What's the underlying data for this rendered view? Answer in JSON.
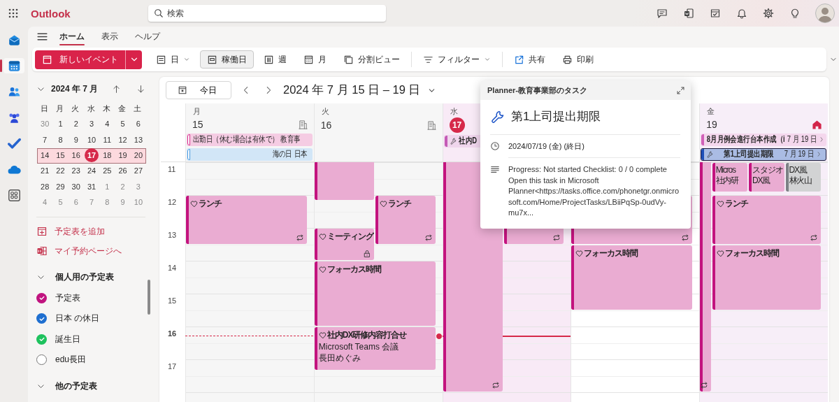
{
  "app_bar": {
    "title": "Outlook",
    "search": {
      "placeholder": "検索"
    },
    "actions": [
      {
        "kind": "chat"
      },
      {
        "kind": "office"
      },
      {
        "kind": "task"
      },
      {
        "kind": "bell"
      },
      {
        "kind": "gear"
      },
      {
        "kind": "bulb"
      }
    ]
  },
  "rail": [
    {
      "kind": "mail",
      "selected": false
    },
    {
      "kind": "calendar",
      "selected": true
    },
    {
      "kind": "people",
      "selected": false
    },
    {
      "kind": "groups",
      "selected": false
    },
    {
      "kind": "todo",
      "selected": false
    },
    {
      "kind": "cloud",
      "selected": false
    },
    {
      "kind": "apps",
      "selected": false
    }
  ],
  "ribbon": {
    "tabs": [
      {
        "label": "ホーム",
        "selected": true
      },
      {
        "label": "表示",
        "selected": false
      },
      {
        "label": "ヘルプ",
        "selected": false
      }
    ],
    "new_event": "新しいイベント",
    "tool_groups": [
      [
        {
          "kind": "day",
          "label": "日",
          "selected": false
        },
        {
          "kind": "workweek",
          "label": "稼働日",
          "selected": true
        },
        {
          "kind": "week",
          "label": "週",
          "selected": false
        },
        {
          "kind": "month",
          "label": "月",
          "selected": false
        },
        {
          "kind": "split",
          "label": "分割ビュー",
          "selected": false
        }
      ],
      [
        {
          "kind": "filter",
          "label": "フィルター",
          "selected": false
        }
      ],
      [
        {
          "kind": "share",
          "label": "共有",
          "selected": false
        },
        {
          "kind": "print",
          "label": "印刷",
          "selected": false
        }
      ]
    ]
  },
  "mini_calendar": {
    "title": "2024 年 7 月",
    "weekdays": [
      "日",
      "月",
      "火",
      "水",
      "木",
      "金",
      "土"
    ],
    "weeks": [
      {
        "selected": false,
        "days": [
          {
            "label": "30",
            "other_month": true,
            "today": false
          },
          {
            "label": "1",
            "other_month": false,
            "today": false
          },
          {
            "label": "2",
            "other_month": false,
            "today": false
          },
          {
            "label": "3",
            "other_month": false,
            "today": false
          },
          {
            "label": "4",
            "other_month": false,
            "today": false
          },
          {
            "label": "5",
            "other_month": false,
            "today": false
          },
          {
            "label": "6",
            "other_month": false,
            "today": false
          }
        ]
      },
      {
        "selected": false,
        "days": [
          {
            "label": "7",
            "other_month": false,
            "today": false
          },
          {
            "label": "8",
            "other_month": false,
            "today": false
          },
          {
            "label": "9",
            "other_month": false,
            "today": false
          },
          {
            "label": "10",
            "other_month": false,
            "today": false
          },
          {
            "label": "11",
            "other_month": false,
            "today": false
          },
          {
            "label": "12",
            "other_month": false,
            "today": false
          },
          {
            "label": "13",
            "other_month": false,
            "today": false
          }
        ]
      },
      {
        "selected": true,
        "days": [
          {
            "label": "14",
            "other_month": false,
            "today": false
          },
          {
            "label": "15",
            "other_month": false,
            "today": false
          },
          {
            "label": "16",
            "other_month": false,
            "today": false
          },
          {
            "label": "17",
            "other_month": false,
            "today": true
          },
          {
            "label": "18",
            "other_month": false,
            "today": false
          },
          {
            "label": "19",
            "other_month": false,
            "today": false
          },
          {
            "label": "20",
            "other_month": false,
            "today": false
          }
        ]
      },
      {
        "selected": false,
        "days": [
          {
            "label": "21",
            "other_month": false,
            "today": false
          },
          {
            "label": "22",
            "other_month": false,
            "today": false
          },
          {
            "label": "23",
            "other_month": false,
            "today": false
          },
          {
            "label": "24",
            "other_month": false,
            "today": false
          },
          {
            "label": "25",
            "other_month": false,
            "today": false
          },
          {
            "label": "26",
            "other_month": false,
            "today": false
          },
          {
            "label": "27",
            "other_month": false,
            "today": false
          }
        ]
      },
      {
        "selected": false,
        "days": [
          {
            "label": "28",
            "other_month": false,
            "today": false
          },
          {
            "label": "29",
            "other_month": false,
            "today": false
          },
          {
            "label": "30",
            "other_month": false,
            "today": false
          },
          {
            "label": "31",
            "other_month": false,
            "today": false
          },
          {
            "label": "1",
            "other_month": true,
            "today": false
          },
          {
            "label": "2",
            "other_month": true,
            "today": false
          },
          {
            "label": "3",
            "other_month": true,
            "today": false
          }
        ]
      },
      {
        "selected": false,
        "days": [
          {
            "label": "4",
            "other_month": true,
            "today": false
          },
          {
            "label": "5",
            "other_month": true,
            "today": false
          },
          {
            "label": "6",
            "other_month": true,
            "today": false
          },
          {
            "label": "7",
            "other_month": true,
            "today": false
          },
          {
            "label": "8",
            "other_month": true,
            "today": false
          },
          {
            "label": "9",
            "other_month": true,
            "today": false
          },
          {
            "label": "10",
            "other_month": true,
            "today": false
          }
        ]
      }
    ]
  },
  "links": [
    {
      "kind": "calendar-add",
      "label": "予定表を追加"
    },
    {
      "kind": "booking",
      "label": "マイ予約ページへ"
    }
  ],
  "calendar_groups": [
    {
      "title": "個人用の予定表",
      "expanded": true,
      "items": [
        {
          "label": "予定表",
          "checked": true,
          "color": "#c0137f"
        },
        {
          "label": "日本 の休日",
          "checked": true,
          "color": "#1f6fd0"
        },
        {
          "label": "誕生日",
          "checked": true,
          "color": "#1ec25e"
        },
        {
          "label": "edu長田",
          "checked": false
        }
      ]
    },
    {
      "title": "他の予定表",
      "expanded": true
    }
  ],
  "week": {
    "today_button": "今日",
    "range": "2024 年 7 月 15 日 – 19 日",
    "hours": [
      "11",
      "12",
      "13",
      "14",
      "15",
      "16",
      "17"
    ],
    "days": [
      {
        "weekday": "月",
        "date": "15",
        "today": false,
        "past": true,
        "highlighted": false,
        "office": true,
        "home": false,
        "all_day": [
          {
            "title": "出勤日（休む場合は有休で） 教育事",
            "color": "#d6338f",
            "tentative": true,
            "task": false,
            "selected": false
          },
          {
            "title": "海の日 日本",
            "color": "#4a9be0",
            "tentative": true,
            "task": false,
            "selected": false
          }
        ],
        "events": [
          {
            "title": "ランチ",
            "favorite": true,
            "recurring": true,
            "locked": false,
            "color": "#c3137e"
          }
        ]
      },
      {
        "weekday": "火",
        "date": "16",
        "today": false,
        "past": true,
        "highlighted": false,
        "office": true,
        "home": false,
        "events": [
          {
            "favorite": false,
            "recurring": false,
            "locked": false,
            "color": "#c3137e"
          },
          {
            "title": "ランチ",
            "favorite": true,
            "recurring": true,
            "locked": false,
            "color": "#c3137e"
          },
          {
            "title": "ミーティング",
            "favorite": true,
            "recurring": false,
            "locked": true,
            "color": "#c3137e"
          },
          {
            "title": "フォーカス時間",
            "favorite": true,
            "recurring": false,
            "locked": false,
            "color": "#c3137e"
          },
          {
            "title": "社内DX研修内容打合せ",
            "favorite": true,
            "lines": [
              "Microsoft Teams 会議",
              "長田めぐみ"
            ],
            "recurring": false,
            "locked": false,
            "color": "#c3137e"
          }
        ]
      },
      {
        "weekday": "水",
        "date": "17",
        "today": true,
        "past": false,
        "highlighted": false,
        "office": false,
        "home": false,
        "all_day": [
          {
            "title": "社内D",
            "color": "#c45ab6",
            "tentative": false,
            "task": true,
            "selected": false
          }
        ],
        "events": [
          {
            "favorite": false,
            "recurring": true,
            "locked": false,
            "color": "#c3137e"
          },
          {
            "favorite": false,
            "recurring": true,
            "locked": false,
            "color": "#c3137e"
          }
        ]
      },
      {
        "today": false,
        "past": false,
        "highlighted": false,
        "office": false,
        "home": false,
        "events": [
          {
            "favorite": false,
            "recurring": true,
            "locked": false,
            "color": "#c3137e"
          },
          {
            "title": "フォーカス時間",
            "favorite": true,
            "recurring": false,
            "locked": false,
            "color": "#c3137e"
          }
        ]
      },
      {
        "weekday": "金",
        "date": "19",
        "today": false,
        "past": false,
        "highlighted": true,
        "office": false,
        "home": true,
        "all_day": [
          {
            "title": "8月月例会進行台本作成（i",
            "date": "7 月 19 日",
            "color": "#d160b8",
            "tentative": false,
            "task": false,
            "selected": false
          },
          {
            "title": "第1上司提出期限",
            "date": "7 月 19 日",
            "color": "#1f4fb8",
            "tentative": false,
            "task": true,
            "selected": true
          }
        ],
        "events": [
          {
            "favorite": false,
            "recurring": true,
            "locked": false,
            "color": "#c3137e"
          },
          {
            "lines": [
              "Micros",
              "社内研"
            ],
            "favorite": false,
            "recurring": false,
            "locked": false,
            "color": "#c3137e"
          },
          {
            "lines": [
              "スタジオ",
              "DX風"
            ],
            "favorite": false,
            "recurring": false,
            "locked": false,
            "color": "#c3137e"
          },
          {
            "lines": [
              "DX風",
              "林火山"
            ],
            "favorite": false,
            "recurring": false,
            "locked": false,
            "color": "#7d8185"
          },
          {
            "title": "ランチ",
            "favorite": true,
            "recurring": true,
            "locked": false,
            "color": "#c3137e"
          },
          {
            "title": "フォーカス時間",
            "favorite": true,
            "recurring": false,
            "locked": false,
            "color": "#c3137e"
          }
        ]
      }
    ]
  },
  "popover": {
    "header": "Planner-教育事業部のタスク",
    "title": "第1上司提出期限",
    "date": "2024/07/19 (金) (終日)",
    "notes": "Progress: Not started Checklist: 0 / 0 complete\nOpen this task in Microsoft Planner<https://tasks.office.com/phonetgr.onmicrosoft.com/Home/ProjectTasks/LBiiPqSp-0udVy-mu7x..."
  }
}
